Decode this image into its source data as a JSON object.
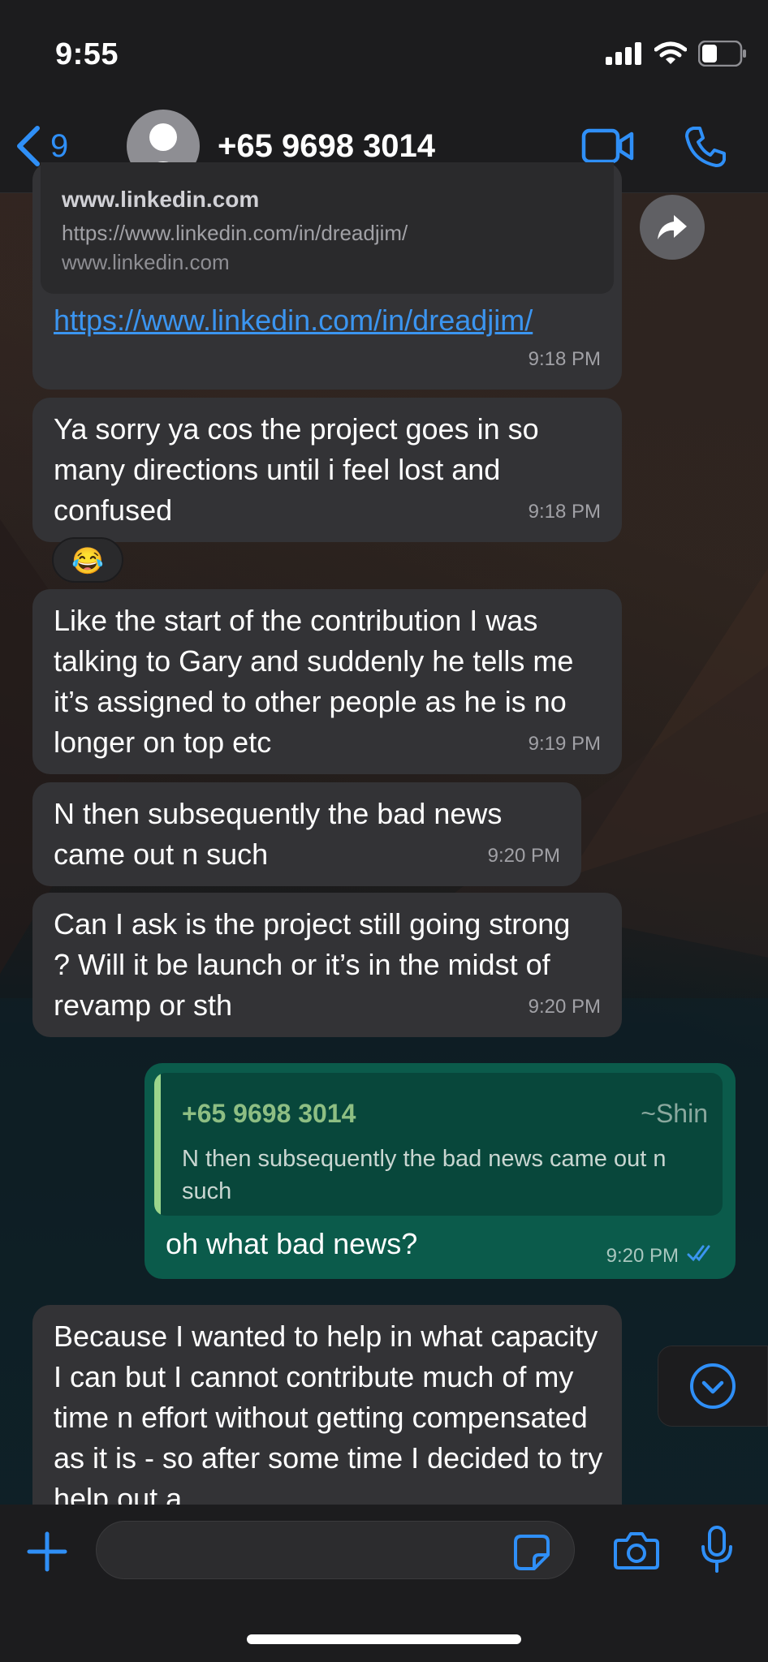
{
  "status_bar": {
    "time": "9:55"
  },
  "header": {
    "back_count": "9",
    "contact_name": "+65 9698 3014"
  },
  "messages": {
    "link_card": {
      "preview_title": "www.linkedin.com",
      "preview_url": "https://www.linkedin.com/in/dreadjim/",
      "preview_domain": "www.linkedin.com",
      "link": "https://www.linkedin.com/in/dreadjim/",
      "time": "9:18 PM"
    },
    "msg1": {
      "text": "Ya sorry ya cos the project goes in so many directions until i feel lost and confused",
      "time": "9:18 PM",
      "reaction": "😂"
    },
    "msg2": {
      "text": "Like the start of the contribution I was talking to Gary and suddenly he tells me it’s assigned to other people as he is no longer on top etc",
      "time": "9:19 PM"
    },
    "msg3": {
      "text": "N then subsequently the bad news came out n such",
      "time": "9:20 PM"
    },
    "msg4": {
      "text": "Can I ask is the project still going strong ? Will it be launch or it’s in the midst of revamp or sth",
      "time": "9:20 PM"
    },
    "sent": {
      "quote_name": "+65 9698 3014",
      "quote_alias": "~Shin",
      "quote_text": "N then subsequently the bad news came out n such",
      "text": "oh what bad news?",
      "time": "9:20 PM"
    },
    "msg5": {
      "text": "Because I wanted to help in what capacity I can but I cannot contribute much of my time n effort without getting compensated as it is - so after some time I decided to try help out a"
    }
  },
  "colors": {
    "accent": "#2f8ff7",
    "incoming": "#333336",
    "outgoing": "#0b5b4b",
    "quote_name": "#8ebe83"
  },
  "icons": [
    "back-chevron-icon",
    "avatar-icon",
    "video-call-icon",
    "phone-icon",
    "forward-icon",
    "scroll-down-icon",
    "plus-icon",
    "sticker-icon",
    "camera-icon",
    "microphone-icon",
    "read-receipt-icon"
  ]
}
